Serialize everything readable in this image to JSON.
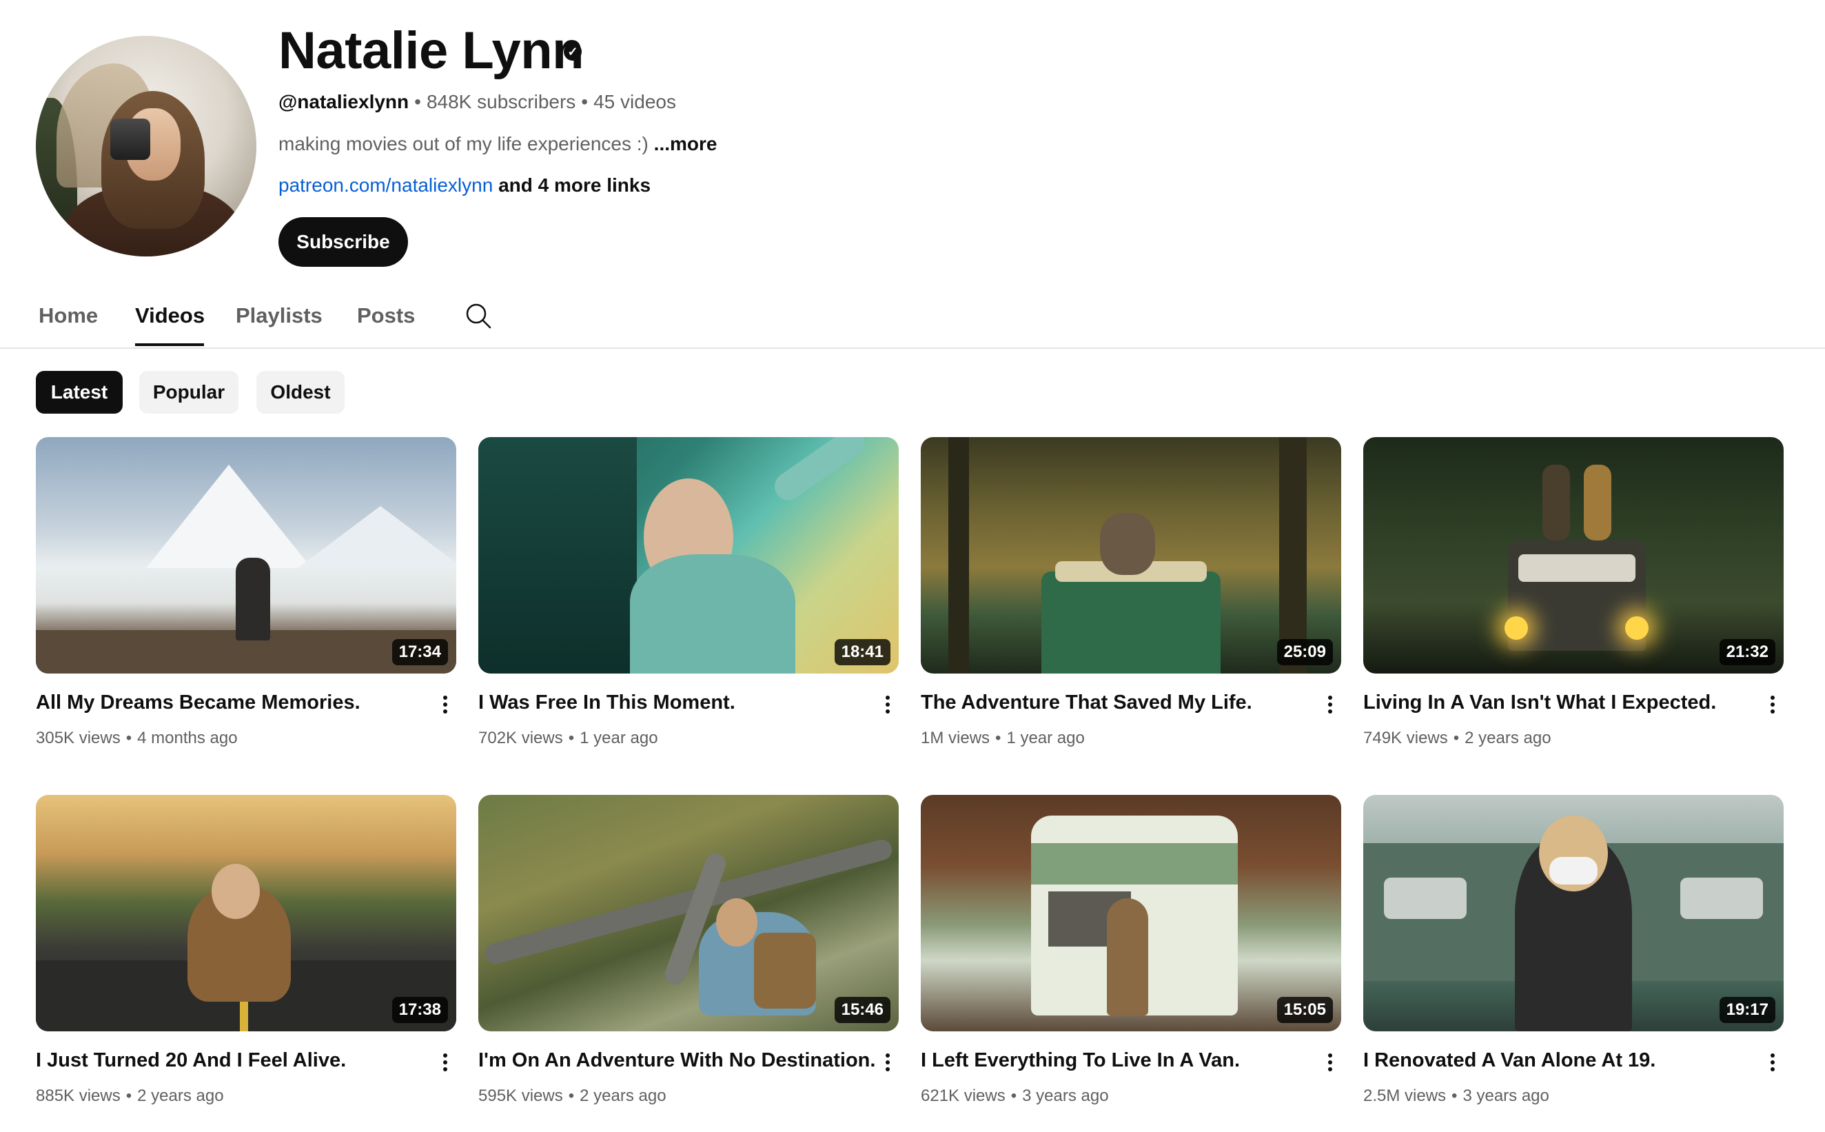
{
  "channel": {
    "name": "Natalie Lynn",
    "handle": "@nataliexlynn",
    "subscribers": "848K subscribers",
    "video_count": "45 videos",
    "description": "making movies out of my life experiences :)",
    "more_label": "...more",
    "link": "patreon.com/nataliexlynn",
    "more_links": "and 4 more links",
    "subscribe_label": "Subscribe",
    "verified_glyph": "✓"
  },
  "tabs": [
    {
      "label": "Home"
    },
    {
      "label": "Videos"
    },
    {
      "label": "Playlists"
    },
    {
      "label": "Posts"
    }
  ],
  "chips": [
    {
      "label": "Latest"
    },
    {
      "label": "Popular"
    },
    {
      "label": "Oldest"
    }
  ],
  "dot": "•",
  "videos": [
    {
      "title": "All My Dreams Became Memories.",
      "views": "305K views",
      "age": "4 months ago",
      "duration": "17:34"
    },
    {
      "title": "I Was Free In This Moment.",
      "views": "702K views",
      "age": "1 year ago",
      "duration": "18:41"
    },
    {
      "title": "The Adventure That Saved My Life.",
      "views": "1M views",
      "age": "1 year ago",
      "duration": "25:09"
    },
    {
      "title": "Living In A Van Isn't What I Expected.",
      "views": "749K views",
      "age": "2 years ago",
      "duration": "21:32"
    },
    {
      "title": "I Just Turned 20 And I Feel Alive.",
      "views": "885K views",
      "age": "2 years ago",
      "duration": "17:38"
    },
    {
      "title": "I'm On An Adventure With No Destination.",
      "views": "595K views",
      "age": "2 years ago",
      "duration": "15:46"
    },
    {
      "title": "I Left Everything To Live In A Van.",
      "views": "621K views",
      "age": "3 years ago",
      "duration": "15:05"
    },
    {
      "title": "I Renovated A Van Alone At 19.",
      "views": "2.5M views",
      "age": "3 years ago",
      "duration": "19:17"
    }
  ]
}
